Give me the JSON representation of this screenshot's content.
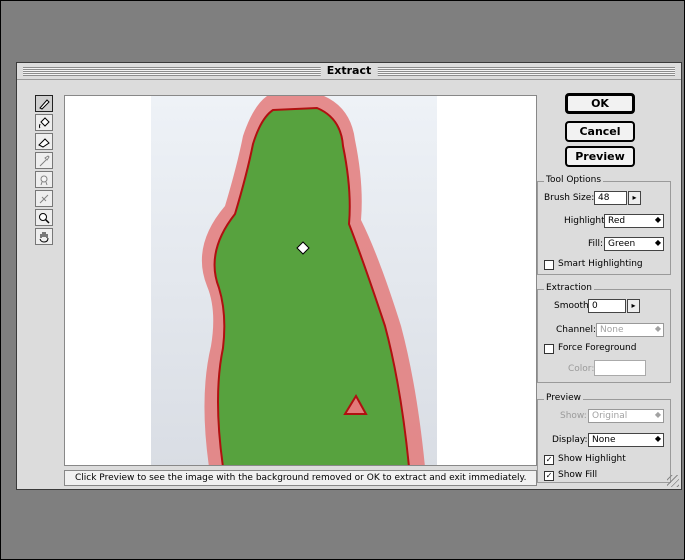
{
  "dialog": {
    "title": "Extract",
    "status_text": "Click Preview to see the image with the background removed or OK to extract and exit immediately."
  },
  "tools": [
    {
      "icon": "edge-highlighter-icon",
      "active": true
    },
    {
      "icon": "fill-bucket-icon",
      "active": false
    },
    {
      "icon": "eraser-icon",
      "active": false
    },
    {
      "icon": "eyedropper-icon",
      "active": false,
      "disabled": true
    },
    {
      "icon": "cleanup-tool-icon",
      "active": false,
      "disabled": true
    },
    {
      "icon": "edge-touchup-icon",
      "active": false,
      "disabled": true
    },
    {
      "icon": "zoom-icon",
      "active": false
    },
    {
      "icon": "hand-icon",
      "active": false
    }
  ],
  "buttons": {
    "ok": "OK",
    "cancel": "Cancel",
    "preview": "Preview"
  },
  "tool_options": {
    "title": "Tool Options",
    "brush_size_label": "Brush Size:",
    "brush_size_value": "48",
    "highlight_label": "Highlight:",
    "highlight_value": "Red",
    "fill_label": "Fill:",
    "fill_value": "Green",
    "smart_highlighting_label": "Smart Highlighting"
  },
  "extraction": {
    "title": "Extraction",
    "smooth_label": "Smooth:",
    "smooth_value": "0",
    "channel_label": "Channel:",
    "channel_value": "None",
    "force_foreground_label": "Force Foreground",
    "color_label": "Color:"
  },
  "preview_group": {
    "title": "Preview",
    "show_label": "Show:",
    "show_value": "Original",
    "display_label": "Display:",
    "display_value": "None",
    "show_highlight_label": "Show Highlight",
    "show_fill_label": "Show Fill"
  },
  "colors": {
    "highlight": "#e37a7a",
    "fill": "#4fa33a",
    "edge": "#b01010"
  }
}
